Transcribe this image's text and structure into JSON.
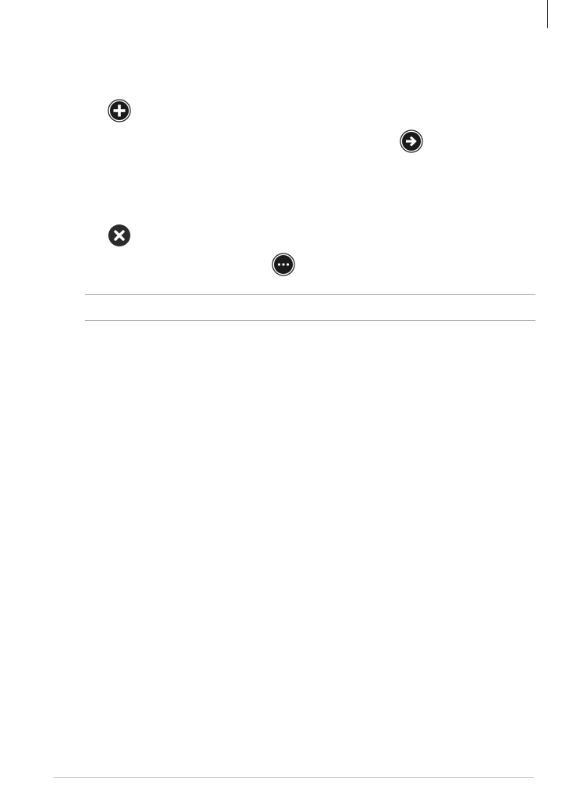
{
  "icons": {
    "add": "plus-circle-icon",
    "next": "arrow-right-circle-icon",
    "close": "x-circle-icon",
    "more": "ellipsis-circle-icon"
  },
  "colors": {
    "icon_fill": "#1a1a1a",
    "close_fill": "#2b2b2b",
    "icon_glyph": "#ffffff",
    "rule": "#a6a6a6",
    "footer_rule": "#cfcfcf"
  }
}
